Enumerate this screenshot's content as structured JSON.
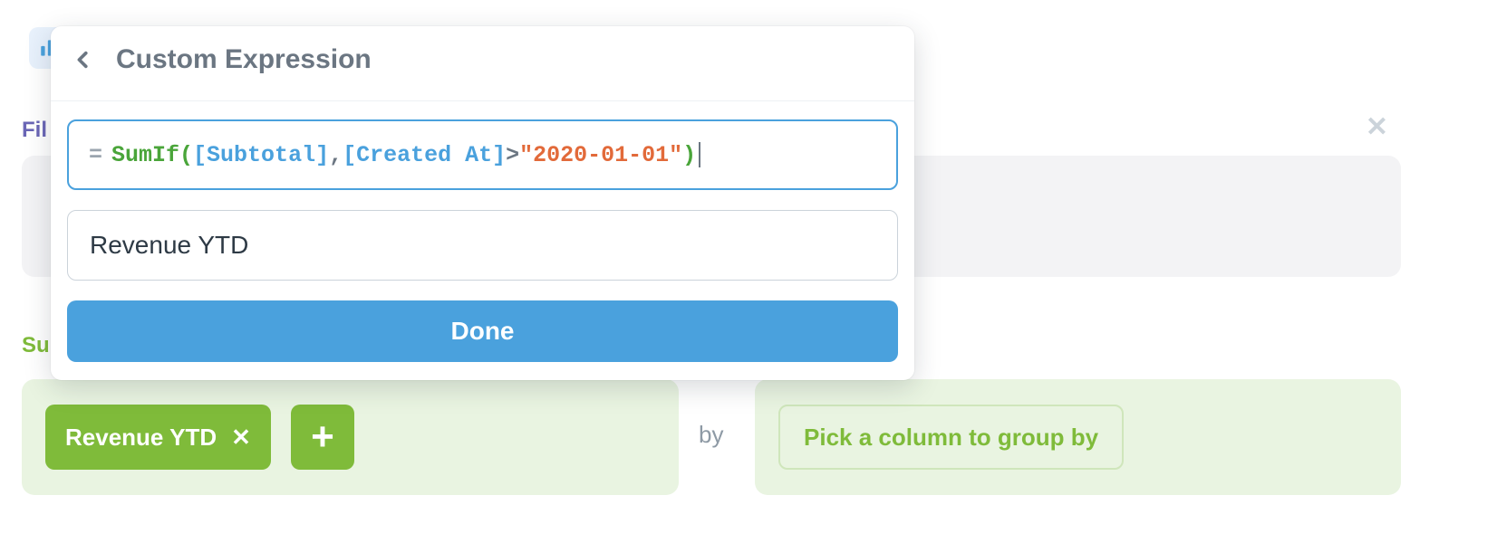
{
  "labels": {
    "filter_partial": "Fil",
    "summarize_partial": "Su",
    "by": "by"
  },
  "popover": {
    "title": "Custom Expression",
    "name_value": "Revenue YTD",
    "done_label": "Done",
    "expression": {
      "equals": "=",
      "function_name": "SumIf",
      "open": "(",
      "field1": "[Subtotal]",
      "comma": ", ",
      "field2": "[Created At]",
      "op": " > ",
      "string": "\"2020-01-01\"",
      "close": ")",
      "raw": "SumIf([Subtotal], [Created At] > \"2020-01-01\")"
    }
  },
  "summarize": {
    "chip_label": "Revenue YTD",
    "groupby_label": "Pick a column to group by"
  }
}
